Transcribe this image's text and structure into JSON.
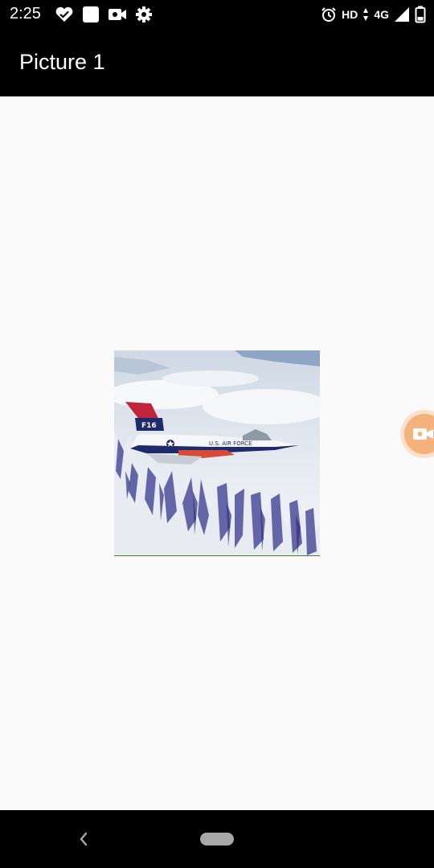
{
  "status_bar": {
    "time": "2:25",
    "left_icons": [
      "heart-check-icon",
      "square-app-icon",
      "video-camera-icon",
      "settings-gear-icon"
    ],
    "network_label": "HD",
    "data_label": "4G",
    "right_icons": [
      "alarm-icon",
      "data-arrows-icon",
      "signal-icon",
      "battery-icon"
    ]
  },
  "app_bar": {
    "title": "Picture 1"
  },
  "image": {
    "description_icon": "fighter-jet-photo",
    "tail_text": "F16",
    "fuselage_text": "U.S. AIR FORCE"
  },
  "floating_button": {
    "icon": "video-camera-icon",
    "color": "#f5b27c"
  },
  "nav_bar": {
    "icons": [
      "back-icon",
      "home-pill-icon"
    ]
  }
}
